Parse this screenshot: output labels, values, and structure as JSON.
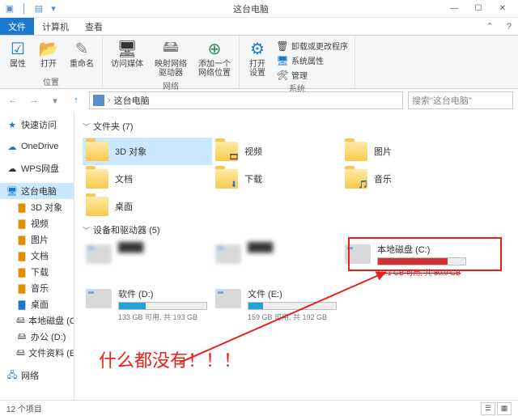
{
  "titlebar": {
    "title": "这台电脑",
    "min": "—",
    "max": "☐",
    "close": "✕"
  },
  "tabs": {
    "file": "文件",
    "computer": "计算机",
    "view": "查看"
  },
  "ribbon": {
    "properties": "属性",
    "open": "打开",
    "rename": "重命名",
    "group_location": "位置",
    "access_media": "访问媒体",
    "map_drive": "映射网络\n驱动器",
    "add_location": "添加一个\n网络位置",
    "group_network": "网络",
    "open_settings": "打开\n设置",
    "uninstall": "卸载或更改程序",
    "system_props": "系统属性",
    "manage": "管理",
    "group_system": "系统"
  },
  "addr": {
    "crumb": "这台电脑",
    "search_placeholder": "搜索\"这台电脑\""
  },
  "sidebar": {
    "quick": "快速访问",
    "onedrive": "OneDrive",
    "wps": "WPS网盘",
    "this_pc": "这台电脑",
    "items": [
      "3D 对象",
      "视频",
      "图片",
      "文档",
      "下载",
      "音乐",
      "桌面",
      "本地磁盘 (C:)",
      "办公 (D:)",
      "文件资料 (E:)"
    ],
    "network": "网络"
  },
  "content": {
    "folders_header": "文件夹 (7)",
    "folders": [
      {
        "name": "3D 对象",
        "badge": ""
      },
      {
        "name": "视频",
        "badge": "🎞"
      },
      {
        "name": "图片",
        "badge": ""
      },
      {
        "name": "文档",
        "badge": ""
      },
      {
        "name": "下载",
        "badge": "⬇"
      },
      {
        "name": "音乐",
        "badge": "🎵"
      },
      {
        "name": "桌面",
        "badge": ""
      }
    ],
    "drives_header": "设备和驱动器 (5)",
    "drives": {
      "c": {
        "name": "本地磁盘 (C:)",
        "meta": "16.1 GB 可用, 共 80.0 GB"
      },
      "d": {
        "name": "软件 (D:)",
        "meta": "133 GB 可用, 共 193 GB"
      },
      "e": {
        "name": "文件 (E:)",
        "meta": "159 GB 可用, 共 192 GB"
      }
    }
  },
  "annotation": "什么都没有！！！",
  "status": {
    "count": "12 个项目"
  }
}
